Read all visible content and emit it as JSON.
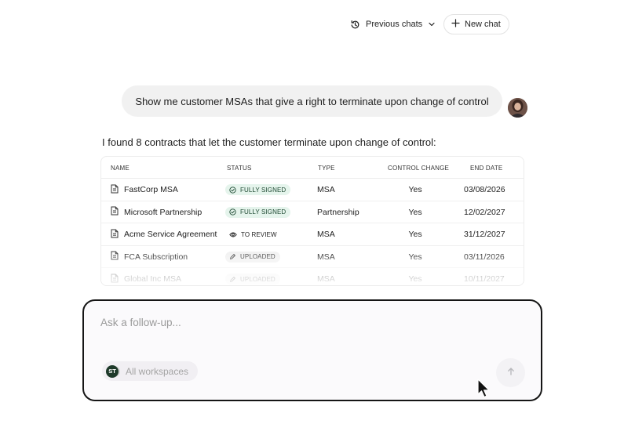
{
  "topbar": {
    "previous_chats_label": "Previous chats",
    "new_chat_label": "New chat"
  },
  "conversation": {
    "user_message": "Show me customer MSAs that give a right to terminate upon change of control",
    "assistant_intro": "I found 8 contracts that let the customer terminate upon change of control:"
  },
  "table": {
    "headers": {
      "name": "NAME",
      "status": "STATUS",
      "type": "TYPE",
      "control_change": "CONTROL CHANGE",
      "end_date": "END DATE"
    },
    "rows": [
      {
        "name": "FastCorp MSA",
        "status": "FULLY SIGNED",
        "status_kind": "signed",
        "type": "MSA",
        "control_change": "Yes",
        "end_date": "03/08/2026"
      },
      {
        "name": "Microsoft Partnership",
        "status": "FULLY SIGNED",
        "status_kind": "signed",
        "type": "Partnership",
        "control_change": "Yes",
        "end_date": "12/02/2027"
      },
      {
        "name": "Acme Service Agreement",
        "status": "TO REVIEW",
        "status_kind": "review",
        "type": "MSA",
        "control_change": "Yes",
        "end_date": "31/12/2027"
      },
      {
        "name": "FCA Subscription",
        "status": "UPLOADED",
        "status_kind": "uploaded",
        "type": "MSA",
        "control_change": "Yes",
        "end_date": "03/11/2026"
      },
      {
        "name": "Global Inc MSA",
        "status": "UPLOADED",
        "status_kind": "uploaded",
        "type": "MSA",
        "control_change": "Yes",
        "end_date": "10/11/2027"
      }
    ]
  },
  "composer": {
    "placeholder": "Ask a follow-up...",
    "workspace_initials": "ST",
    "workspace_label": "All workspaces"
  },
  "colors": {
    "signed_badge_bg": "#e5f4ec",
    "workspace_badge_bg": "#1e3a2a",
    "composer_border": "#151515"
  }
}
